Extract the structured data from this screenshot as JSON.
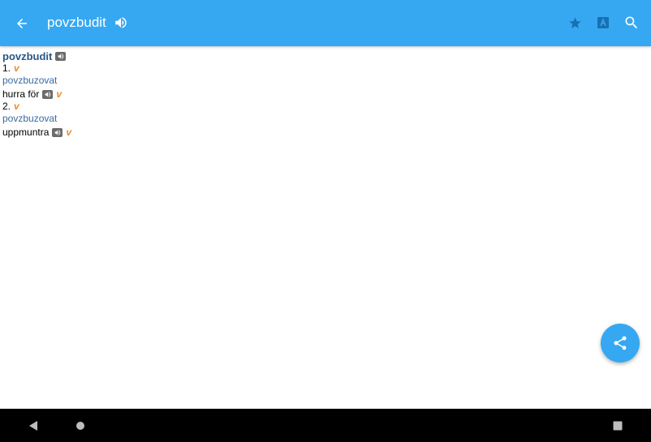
{
  "app_bar": {
    "title": "povzbudit",
    "background": "#36a8f1",
    "icons": {
      "back": "arrow-back-icon",
      "speaker": "speaker-icon",
      "favorite": "star-icon",
      "font": "font-size-icon",
      "search": "search-icon"
    }
  },
  "entry": {
    "headword": "povzbudit",
    "senses": [
      {
        "number": "1.",
        "pos": "v",
        "source": "povzbuzovat",
        "translation": "hurra för",
        "translation_pos": "v"
      },
      {
        "number": "2.",
        "pos": "v",
        "source": "povzbuzovat",
        "translation": "uppmuntra",
        "translation_pos": "v"
      }
    ]
  },
  "fab": {
    "icon": "share-icon",
    "color": "#36a8f1"
  },
  "colors": {
    "headword": "#2a5687",
    "source": "#3b6aa1",
    "pos": "#ee8a2a"
  },
  "nav": {
    "icons": [
      "nav-back-icon",
      "nav-home-icon",
      "nav-recents-icon"
    ]
  }
}
